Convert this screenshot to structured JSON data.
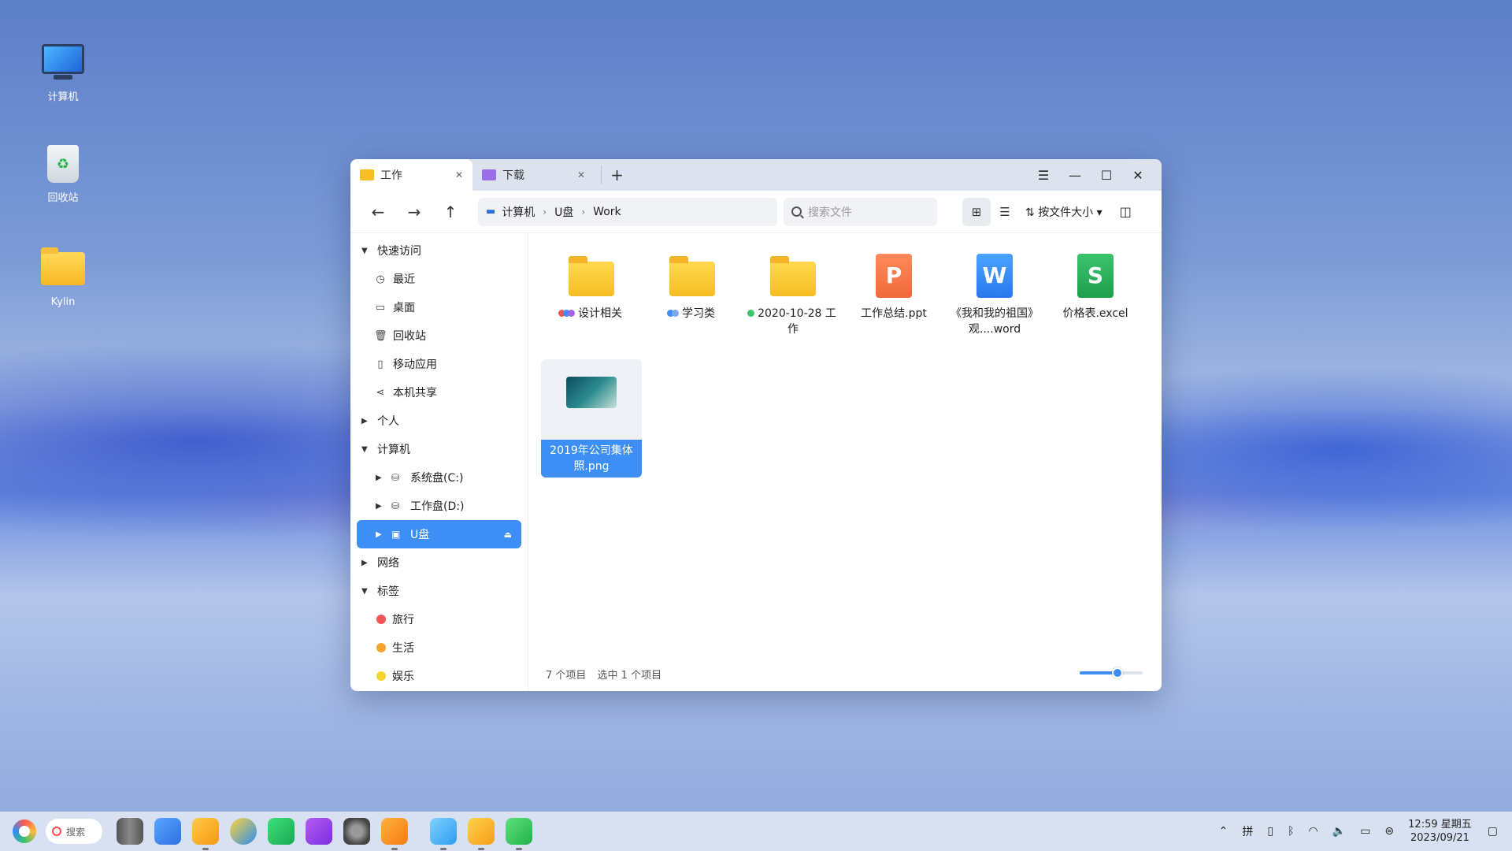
{
  "desktop": {
    "icons": [
      {
        "label": "计算机",
        "icon": "computer-icon"
      },
      {
        "label": "回收站",
        "icon": "recycle-bin-icon"
      },
      {
        "label": "Kylin",
        "icon": "home-folder-icon"
      }
    ]
  },
  "window": {
    "tabs": [
      {
        "label": "工作",
        "icon": "folder-icon",
        "active": true
      },
      {
        "label": "下载",
        "icon": "download-folder-icon",
        "active": false
      }
    ],
    "add_tab": "+",
    "breadcrumb": [
      "计算机",
      "U盘",
      "Work"
    ],
    "search_placeholder": "搜索文件",
    "sort_label": "按文件大小",
    "sidebar": {
      "quick_access": "快速访问",
      "quick_items": [
        {
          "label": "最近",
          "icon": "clock-icon"
        },
        {
          "label": "桌面",
          "icon": "desktop-icon"
        },
        {
          "label": "回收站",
          "icon": "trash-icon"
        },
        {
          "label": "移动应用",
          "icon": "mobile-icon"
        },
        {
          "label": "本机共享",
          "icon": "share-icon"
        }
      ],
      "personal": "个人",
      "computer": "计算机",
      "drives": [
        {
          "label": "系统盘(C:)",
          "icon": "drive-icon"
        },
        {
          "label": "工作盘(D:)",
          "icon": "drive-icon"
        },
        {
          "label": "U盘",
          "icon": "usb-icon",
          "selected": true
        }
      ],
      "network": "网络",
      "tags_header": "标签",
      "tags": [
        {
          "label": "旅行",
          "color": "#f05454"
        },
        {
          "label": "生活",
          "color": "#f7a531"
        },
        {
          "label": "娱乐",
          "color": "#f5d52b"
        }
      ]
    },
    "files": [
      {
        "name": "设计相关",
        "type": "folder",
        "tags": [
          "#f05454",
          "#3d8ff5",
          "#a361e8"
        ]
      },
      {
        "name": "学习类",
        "type": "folder",
        "tags": [
          "#3d8ff5",
          "#7aa8ef"
        ]
      },
      {
        "name": "2020-10-28 工作",
        "type": "folder",
        "tags": [
          "#3bc46a"
        ]
      },
      {
        "name": "工作总结.ppt",
        "type": "ppt"
      },
      {
        "name": "《我和我的祖国》观....word",
        "type": "word"
      },
      {
        "name": "价格表.excel",
        "type": "excel"
      },
      {
        "name": "2019年公司集体照.png",
        "type": "image",
        "selected": true
      }
    ],
    "status": {
      "count": "7 个项目",
      "selected": "选中 1 个项目",
      "zoom_level": 0.6
    }
  },
  "taskbar": {
    "search_label": "搜索",
    "ime": "拼",
    "time": "12:59 星期五",
    "date": "2023/09/21"
  }
}
